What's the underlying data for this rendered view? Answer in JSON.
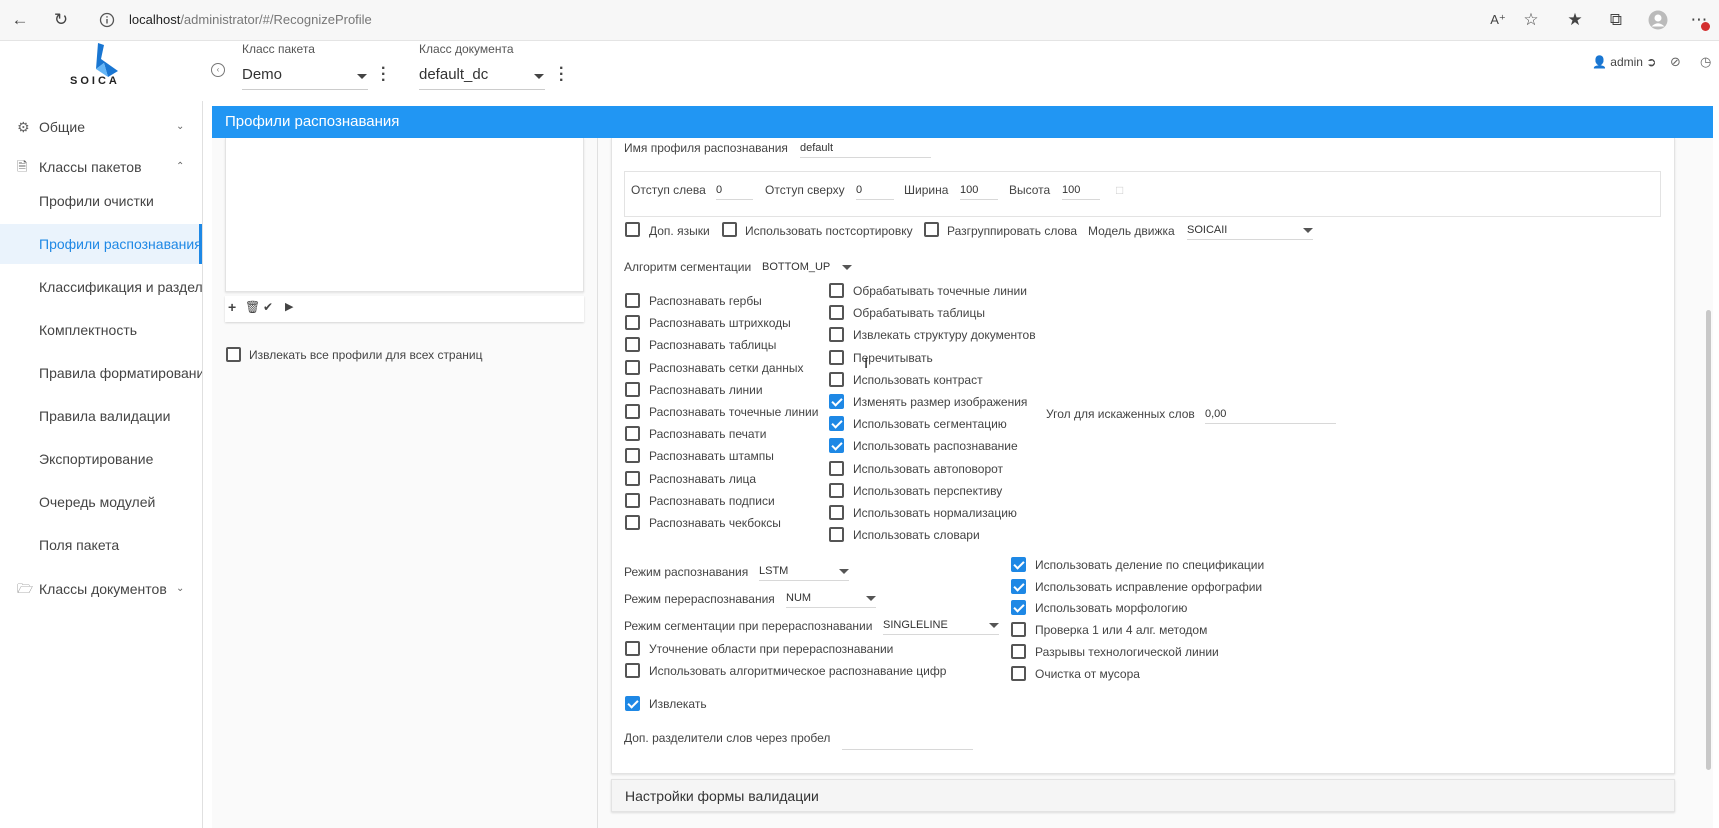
{
  "browser": {
    "url_host": "localhost",
    "url_path": "/administrator/#/RecognizeProfile"
  },
  "header": {
    "logo_text": "SOICA",
    "package_class_label": "Класс пакета",
    "package_class_value": "Demo",
    "document_class_label": "Класс документа",
    "document_class_value": "default_dc",
    "user": "admin"
  },
  "sidebar": {
    "items": [
      {
        "label": "Общие"
      },
      {
        "label": "Классы пакетов"
      },
      {
        "label": "Профили очистки"
      },
      {
        "label": "Профили распознавания"
      },
      {
        "label": "Классификация и разделение"
      },
      {
        "label": "Комплектность"
      },
      {
        "label": "Правила форматирования"
      },
      {
        "label": "Правила валидации"
      },
      {
        "label": "Экспортирование"
      },
      {
        "label": "Очередь модулей"
      },
      {
        "label": "Поля пакета"
      },
      {
        "label": "Классы документов"
      }
    ]
  },
  "page_title": "Профили распознавания",
  "left_panel": {
    "extract_all_label": "Извлекать все профили для всех страниц"
  },
  "form": {
    "profile_name_label": "Имя профиля распознавания",
    "profile_name_value": "default",
    "offset_left_label": "Отступ слева",
    "offset_left_value": "0",
    "offset_top_label": "Отступ сверху",
    "offset_top_value": "0",
    "width_label": "Ширина",
    "width_value": "100",
    "height_label": "Высота",
    "height_value": "100",
    "extra_langs": "Доп. языки",
    "post_sort": "Использовать постсортировку",
    "ungroup_words": "Разгруппировать слова",
    "engine_model_label": "Модель движка",
    "engine_model_value": "SOICAII",
    "seg_algo_label": "Алгоритм сегментации",
    "seg_algo_value": "BOTTOM_UP",
    "col1": [
      {
        "label": "Распознавать гербы",
        "checked": false
      },
      {
        "label": "Распознавать штрихкоды",
        "checked": false
      },
      {
        "label": "Распознавать таблицы",
        "checked": false
      },
      {
        "label": "Распознавать сетки данных",
        "checked": false
      },
      {
        "label": "Распознавать линии",
        "checked": false
      },
      {
        "label": "Распознавать точечные линии",
        "checked": false
      },
      {
        "label": "Распознавать печати",
        "checked": false
      },
      {
        "label": "Распознавать штампы",
        "checked": false
      },
      {
        "label": "Распознавать лица",
        "checked": false
      },
      {
        "label": "Распознавать подписи",
        "checked": false
      },
      {
        "label": "Распознавать чекбоксы",
        "checked": false
      }
    ],
    "col2": [
      {
        "label": "Обрабатывать точечные линии",
        "checked": false
      },
      {
        "label": "Обрабатывать таблицы",
        "checked": false
      },
      {
        "label": "Извлекать структуру документов",
        "checked": false
      },
      {
        "label": "Перечитывать",
        "checked": false
      },
      {
        "label": "Использовать контраст",
        "checked": false
      },
      {
        "label": "Изменять размер изображения",
        "checked": true
      },
      {
        "label": "Использовать сегментацию",
        "checked": true
      },
      {
        "label": "Использовать распознавание",
        "checked": true
      },
      {
        "label": "Использовать автоповорот",
        "checked": false
      },
      {
        "label": "Использовать перспективу",
        "checked": false
      },
      {
        "label": "Использовать нормализацию",
        "checked": false
      },
      {
        "label": "Использовать словари",
        "checked": false
      }
    ],
    "skew_angle_label": "Угол для искаженных слов",
    "skew_angle_value": "0,00",
    "recog_mode_label": "Режим распознавания",
    "recog_mode_value": "LSTM",
    "rerecog_mode_label": "Режим перераспознавания",
    "rerecog_mode_value": "NUM",
    "seg_rerecog_label": "Режим сегментации при перераспознавании",
    "seg_rerecog_value": "SINGLELINE",
    "refine_area": "Уточнение области при перераспознавании",
    "algo_digits": "Использовать алгоритмическое распознавание цифр",
    "extract": "Извлекать",
    "word_separators_label": "Доп. разделители слов через пробел",
    "col3": [
      {
        "label": "Использовать деление по спецификации",
        "checked": true
      },
      {
        "label": "Использовать исправление орфографии",
        "checked": true
      },
      {
        "label": "Использовать морфологию",
        "checked": true
      },
      {
        "label": "Проверка 1 или 4 алг. методом",
        "checked": false
      },
      {
        "label": "Разрывы технологической линии",
        "checked": false
      },
      {
        "label": "Очистка от мусора",
        "checked": false
      }
    ],
    "validation_section": "Настройки формы валидации"
  },
  "colors": {
    "accent": "#2196f3",
    "check": "#1e88e5"
  }
}
